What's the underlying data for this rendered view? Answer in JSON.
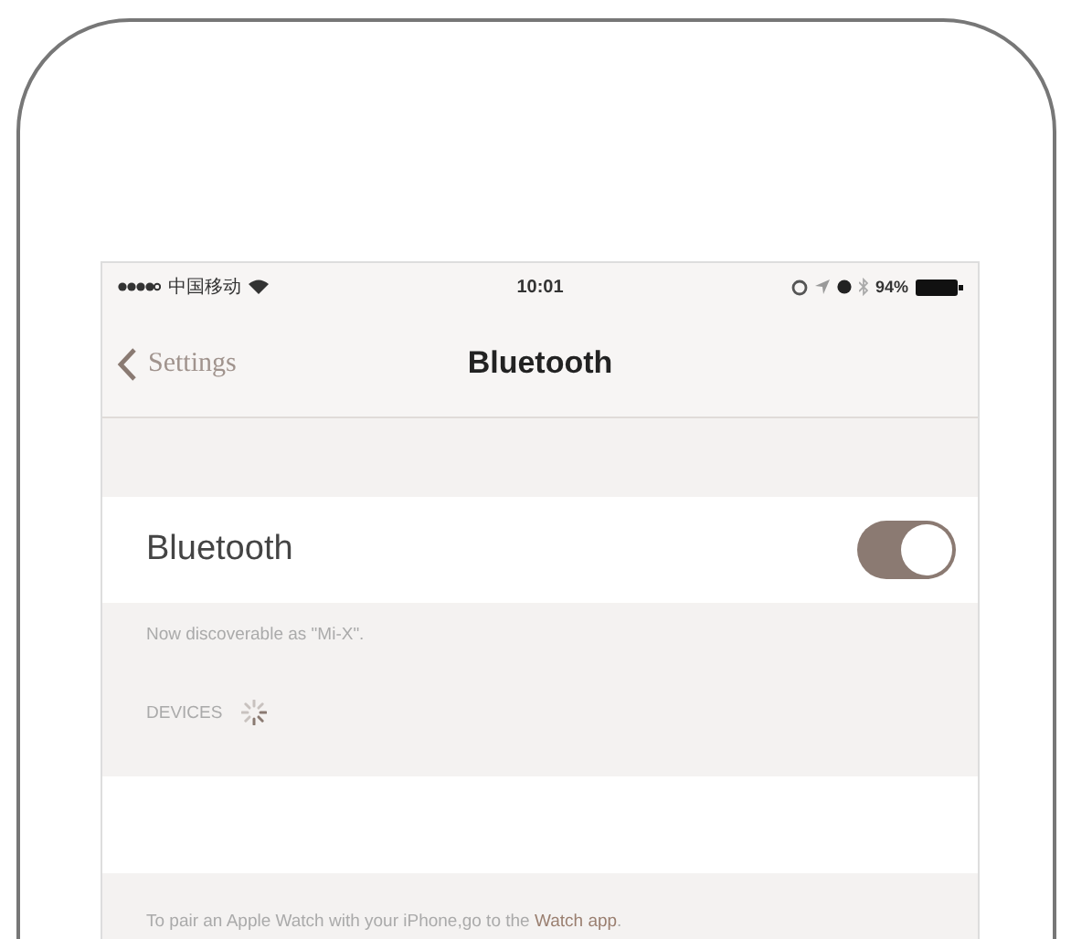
{
  "status_bar": {
    "carrier": "中国移动",
    "time": "10:01",
    "battery": "94%"
  },
  "nav": {
    "back": "Settings",
    "title": "Bluetooth"
  },
  "bluetooth": {
    "label": "Bluetooth",
    "on": true
  },
  "discoverable": "Now discoverable as \"Mi-X\".",
  "devices_header": "DEVICES",
  "footer": {
    "text": "To pair an Apple Watch with your iPhone,go to the ",
    "link": "Watch app",
    "end": "."
  }
}
